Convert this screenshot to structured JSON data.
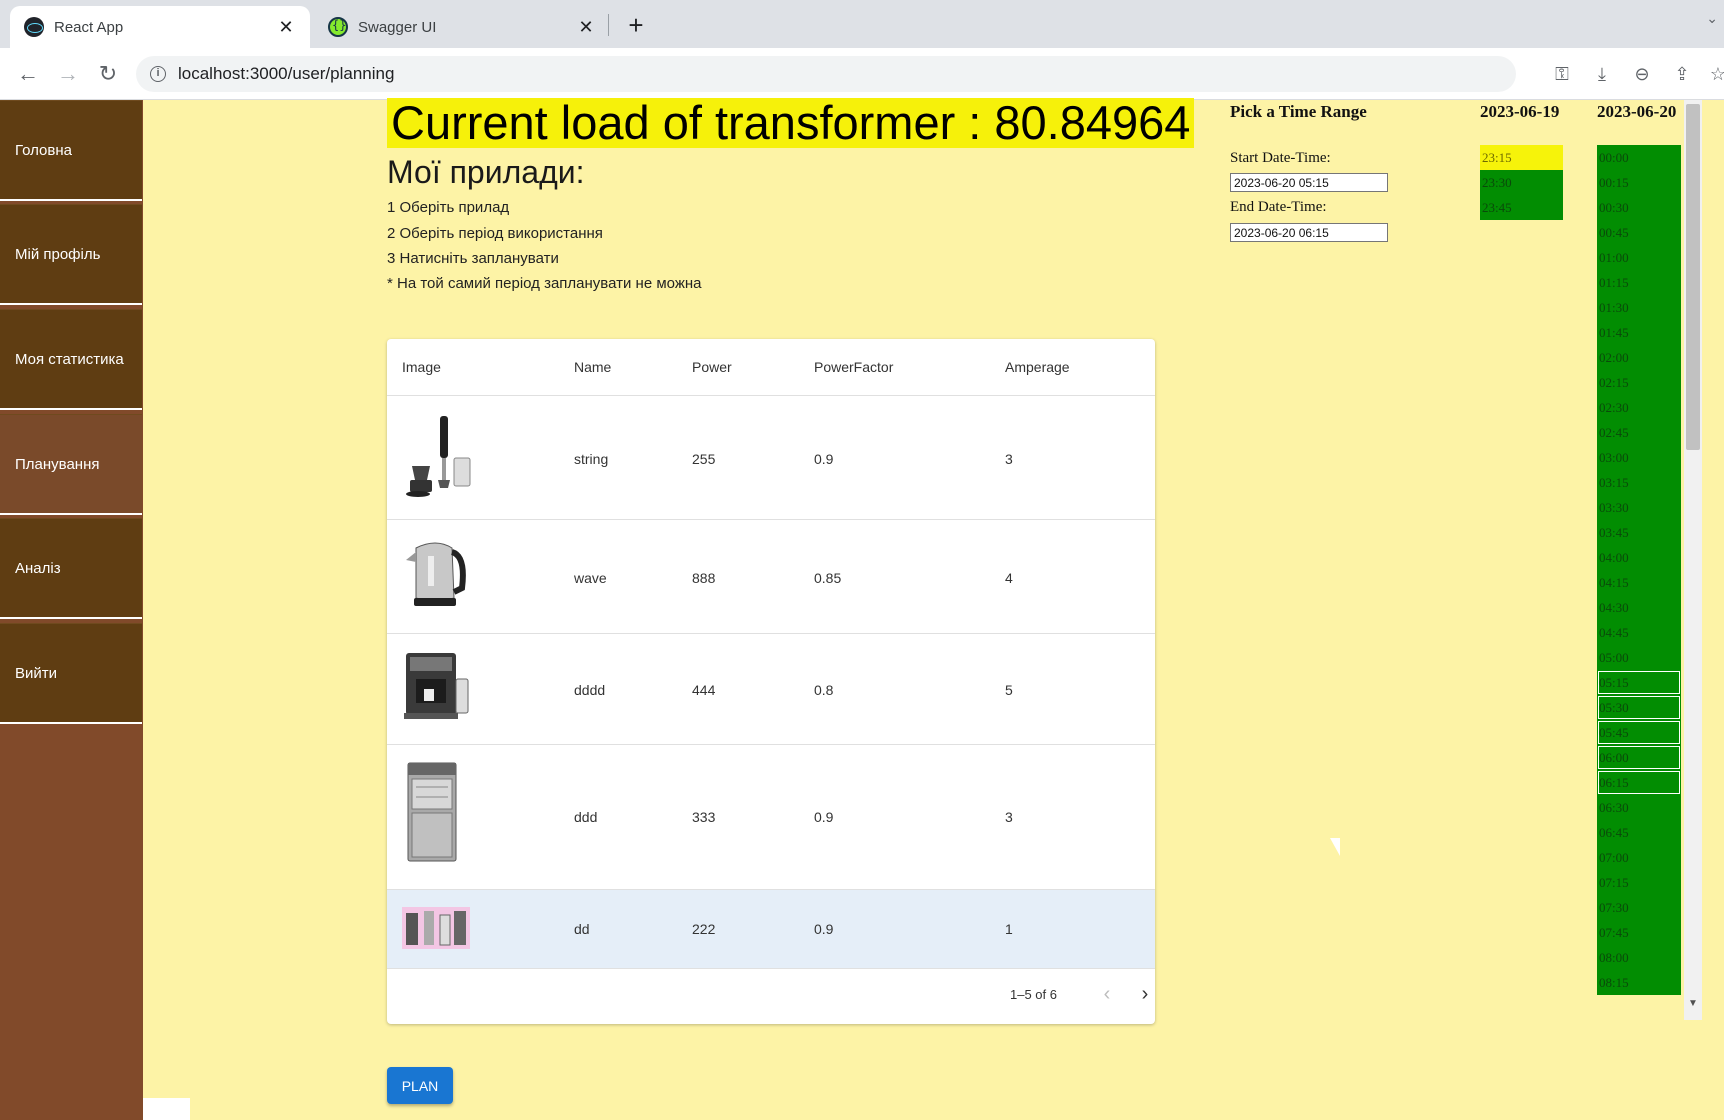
{
  "browser": {
    "tabs": [
      {
        "title": "React App",
        "active": true,
        "icon": "react-icon"
      },
      {
        "title": "Swagger UI",
        "active": false,
        "icon": "swagger-icon"
      }
    ],
    "url": "localhost:3000/user/planning"
  },
  "sidebar": {
    "items": [
      {
        "label": "Головна"
      },
      {
        "label": "Мій профіль"
      },
      {
        "label": "Моя статистика"
      },
      {
        "label": "Планування",
        "active": true
      },
      {
        "label": "Аналіз"
      },
      {
        "label": "Вийти"
      }
    ]
  },
  "header": {
    "title": "Current load of transformer : 80.84964",
    "section_title": "Мої прилади:",
    "instructions": [
      "1 Оберіть прилад",
      "2 Оберіть період використання",
      "3 Натисніть запланувати",
      "* На той самий період запланувати не можна"
    ]
  },
  "table": {
    "columns": [
      "Image",
      "Name",
      "Power",
      "PowerFactor",
      "Amperage"
    ],
    "rows": [
      {
        "image": "hand-blender-image",
        "name": "string",
        "power": "255",
        "power_factor": "0.9",
        "amperage": "3"
      },
      {
        "image": "kettle-image",
        "name": "wave",
        "power": "888",
        "power_factor": "0.85",
        "amperage": "4"
      },
      {
        "image": "coffee-machine-image",
        "name": "dddd",
        "power": "444",
        "power_factor": "0.8",
        "amperage": "5"
      },
      {
        "image": "dishwasher-image",
        "name": "ddd",
        "power": "333",
        "power_factor": "0.9",
        "amperage": "3"
      },
      {
        "image": "blender-set-image",
        "name": "dd",
        "power": "222",
        "power_factor": "0.9",
        "amperage": "1",
        "selected": true
      }
    ],
    "pagination": "1–5 of 6"
  },
  "plan_button": "PLAN",
  "time_range": {
    "title": "Pick a Time Range",
    "start_label": "Start Date-Time:",
    "start_value": "2023-06-20 05:15",
    "end_label": "End Date-Time:",
    "end_value": "2023-06-20 06:15",
    "day1": {
      "date": "2023-06-19",
      "slots": [
        "23:15",
        "23:30",
        "23:45"
      ]
    },
    "day2": {
      "date": "2023-06-20",
      "slots": [
        "00:00",
        "00:15",
        "00:30",
        "00:45",
        "01:00",
        "01:15",
        "01:30",
        "01:45",
        "02:00",
        "02:15",
        "02:30",
        "02:45",
        "03:00",
        "03:15",
        "03:30",
        "03:45",
        "04:00",
        "04:15",
        "04:30",
        "04:45",
        "05:00",
        "05:15",
        "05:30",
        "05:45",
        "06:00",
        "06:15",
        "06:30",
        "06:45",
        "07:00",
        "07:15",
        "07:30",
        "07:45",
        "08:00",
        "08:15"
      ]
    },
    "colors": {
      "free": "#028d02",
      "current": "#f6f30a",
      "selected_outline": "#ffffff"
    }
  }
}
